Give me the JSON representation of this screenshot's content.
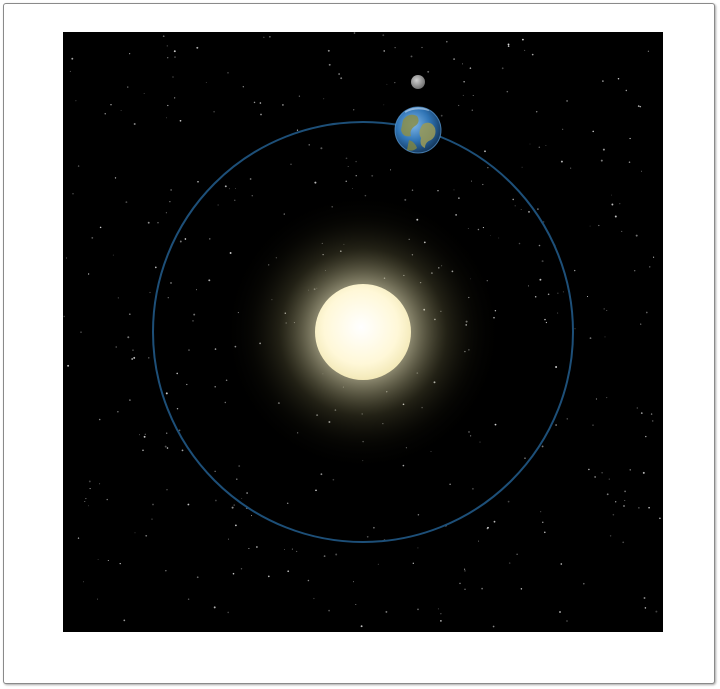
{
  "scene": {
    "background_color": "#000000",
    "frame_border_color": "#8a8a8a",
    "orbit_color": "#1d4f78",
    "sun_core_color": "#fffbe0",
    "sun_glow_color": "#f5eebf",
    "earth_ocean_color": "#2f74b5",
    "earth_land_color": "#8a8f4a",
    "moon_color": "#8c8c8c",
    "star_color": "#ffffff",
    "icons": [
      "sun-icon",
      "earth-icon",
      "moon-icon",
      "orbit-path",
      "starfield"
    ]
  }
}
